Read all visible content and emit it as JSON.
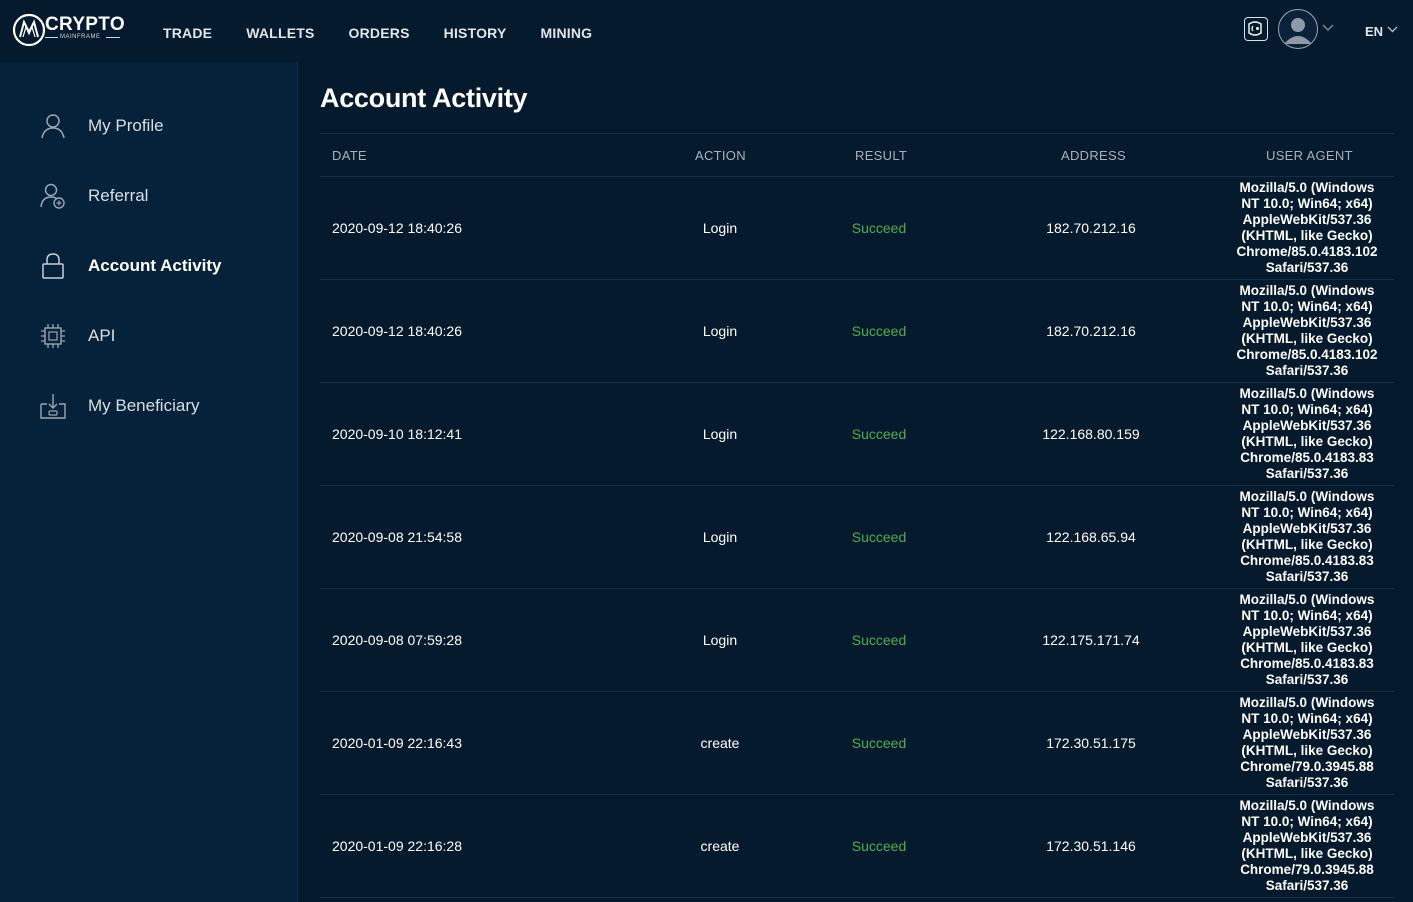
{
  "brand": {
    "name": "CRYPTO",
    "sub": "MAINFRAME"
  },
  "nav": [
    {
      "label": "TRADE"
    },
    {
      "label": "WALLETS"
    },
    {
      "label": "ORDERS"
    },
    {
      "label": "HISTORY"
    },
    {
      "label": "MINING"
    }
  ],
  "header": {
    "language": "EN",
    "wallet_icon": "wallet-icon",
    "avatar_icon": "user-avatar"
  },
  "sidebar": {
    "items": [
      {
        "label": "My Profile",
        "icon": "user-icon",
        "active": false
      },
      {
        "label": "Referral",
        "icon": "add-user-icon",
        "active": false
      },
      {
        "label": "Account Activity",
        "icon": "lock-icon",
        "active": true
      },
      {
        "label": "API",
        "icon": "chip-icon",
        "active": false
      },
      {
        "label": "My Beneficiary",
        "icon": "beneficiary-icon",
        "active": false
      }
    ]
  },
  "main": {
    "title": "Account Activity",
    "columns": [
      "DATE",
      "ACTION",
      "RESULT",
      "ADDRESS",
      "USER AGENT"
    ],
    "rows": [
      {
        "date": "2020-09-12 18:40:26",
        "action": "Login",
        "result": "Succeed",
        "address": "182.70.212.16",
        "agent": [
          "Mozilla/5.0 (Windows",
          "NT 10.0; Win64; x64)",
          "AppleWebKit/537.36",
          "(KHTML, like Gecko)",
          "Chrome/85.0.4183.102",
          "Safari/537.36"
        ]
      },
      {
        "date": "2020-09-12 18:40:26",
        "action": "Login",
        "result": "Succeed",
        "address": "182.70.212.16",
        "agent": [
          "Mozilla/5.0 (Windows",
          "NT 10.0; Win64; x64)",
          "AppleWebKit/537.36",
          "(KHTML, like Gecko)",
          "Chrome/85.0.4183.102",
          "Safari/537.36"
        ]
      },
      {
        "date": "2020-09-10 18:12:41",
        "action": "Login",
        "result": "Succeed",
        "address": "122.168.80.159",
        "agent": [
          "Mozilla/5.0 (Windows",
          "NT 10.0; Win64; x64)",
          "AppleWebKit/537.36",
          "(KHTML, like Gecko)",
          "Chrome/85.0.4183.83",
          "Safari/537.36"
        ]
      },
      {
        "date": "2020-09-08 21:54:58",
        "action": "Login",
        "result": "Succeed",
        "address": "122.168.65.94",
        "agent": [
          "Mozilla/5.0 (Windows",
          "NT 10.0; Win64; x64)",
          "AppleWebKit/537.36",
          "(KHTML, like Gecko)",
          "Chrome/85.0.4183.83",
          "Safari/537.36"
        ]
      },
      {
        "date": "2020-09-08 07:59:28",
        "action": "Login",
        "result": "Succeed",
        "address": "122.175.171.74",
        "agent": [
          "Mozilla/5.0 (Windows",
          "NT 10.0; Win64; x64)",
          "AppleWebKit/537.36",
          "(KHTML, like Gecko)",
          "Chrome/85.0.4183.83",
          "Safari/537.36"
        ]
      },
      {
        "date": "2020-01-09 22:16:43",
        "action": "create",
        "result": "Succeed",
        "address": "172.30.51.175",
        "agent": [
          "Mozilla/5.0 (Windows",
          "NT 10.0; Win64; x64)",
          "AppleWebKit/537.36",
          "(KHTML, like Gecko)",
          "Chrome/79.0.3945.88",
          "Safari/537.36"
        ]
      },
      {
        "date": "2020-01-09 22:16:28",
        "action": "create",
        "result": "Succeed",
        "address": "172.30.51.146",
        "agent": [
          "Mozilla/5.0 (Windows",
          "NT 10.0; Win64; x64)",
          "AppleWebKit/537.36",
          "(KHTML, like Gecko)",
          "Chrome/79.0.3945.88",
          "Safari/537.36"
        ]
      }
    ]
  },
  "colors": {
    "background": "#051a2c",
    "sidebar": "#06223a",
    "success": "#4caf50"
  }
}
